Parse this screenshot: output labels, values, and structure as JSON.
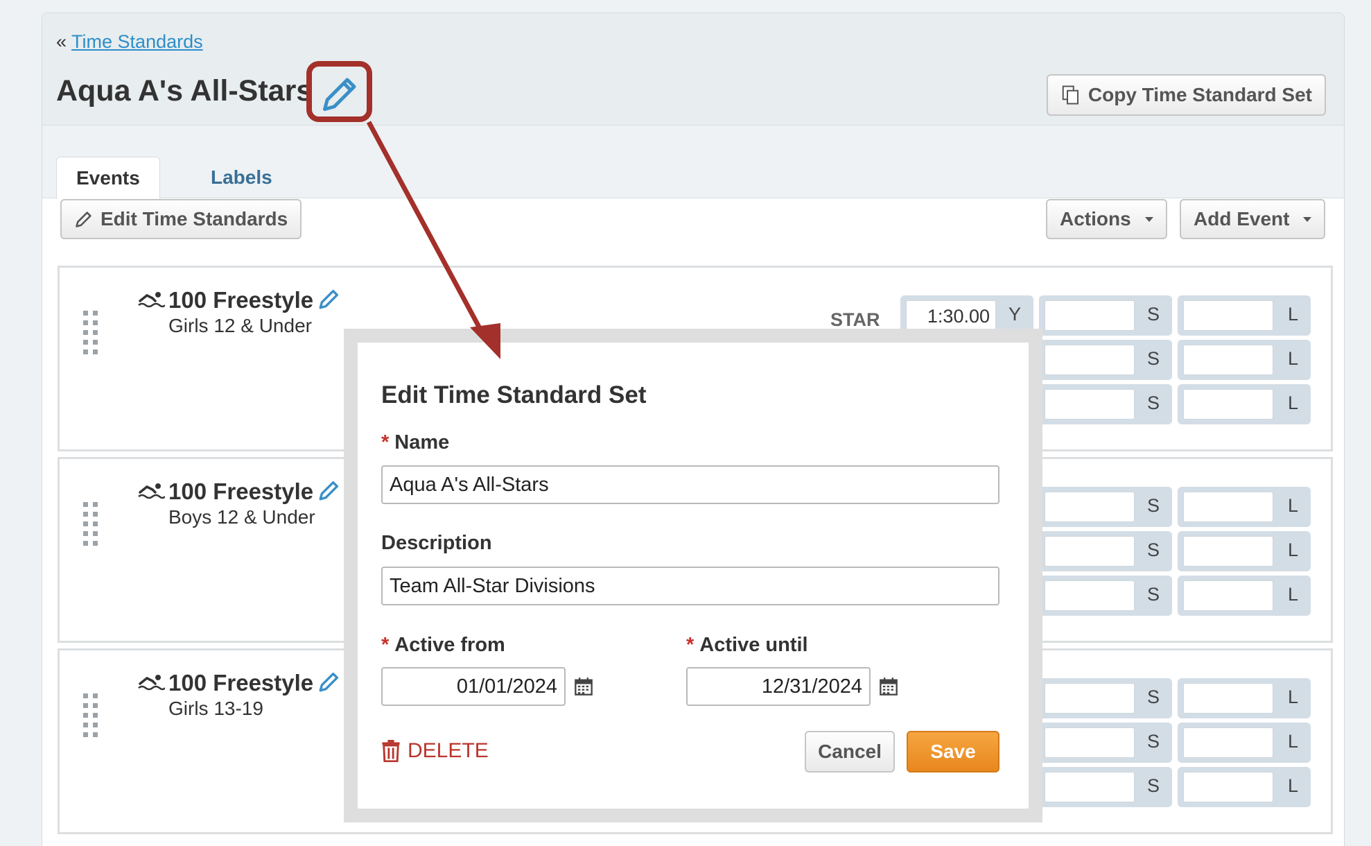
{
  "breadcrumb": {
    "prefix": "«",
    "link": "Time Standards"
  },
  "page": {
    "title": "Aqua A's All-Stars"
  },
  "header": {
    "copy_button": "Copy Time Standard Set"
  },
  "tabs": [
    {
      "label": "Events",
      "active": true
    },
    {
      "label": "Labels",
      "active": false
    }
  ],
  "toolbar": {
    "edit_button": "Edit Time Standards",
    "actions_button": "Actions",
    "add_event_button": "Add Event"
  },
  "events": [
    {
      "name": "100 Freestyle",
      "group": "Girls 12 & Under",
      "standard_label": "STAR",
      "rows": [
        {
          "y": "1:30.00",
          "s": "",
          "l": ""
        },
        {
          "y": "",
          "s": "",
          "l": ""
        },
        {
          "y": "",
          "s": "",
          "l": ""
        }
      ]
    },
    {
      "name": "100 Freestyle",
      "group": "Boys 12 & Under",
      "rows": [
        {
          "y": "",
          "s": "",
          "l": ""
        },
        {
          "y": "",
          "s": "",
          "l": ""
        },
        {
          "y": "",
          "s": "",
          "l": ""
        }
      ]
    },
    {
      "name": "100 Freestyle",
      "group": "Girls 13-19",
      "rows": [
        {
          "y": "",
          "s": "",
          "l": ""
        },
        {
          "y": "",
          "s": "",
          "l": ""
        },
        {
          "y": "",
          "s": "",
          "l": ""
        }
      ]
    }
  ],
  "course_codes": {
    "y": "Y",
    "s": "S",
    "l": "L"
  },
  "modal": {
    "title": "Edit Time Standard Set",
    "name_label": "Name",
    "name_value": "Aqua A's All-Stars",
    "description_label": "Description",
    "description_value": "Team All-Star Divisions",
    "active_from_label": "Active from",
    "active_from_value": "01/01/2024",
    "active_until_label": "Active until",
    "active_until_value": "12/31/2024",
    "required_mark": "*",
    "delete_label": "DELETE",
    "cancel_label": "Cancel",
    "save_label": "Save"
  },
  "colors": {
    "accent_link": "#2d8ec9",
    "annotation": "#a3302a",
    "save": "#e8871d",
    "delete": "#b9352d"
  },
  "icons": [
    "pencil-icon",
    "copy-icon",
    "swimmer-icon",
    "drag-handle-icon",
    "calendar-icon",
    "trash-icon",
    "caret-down-icon"
  ]
}
